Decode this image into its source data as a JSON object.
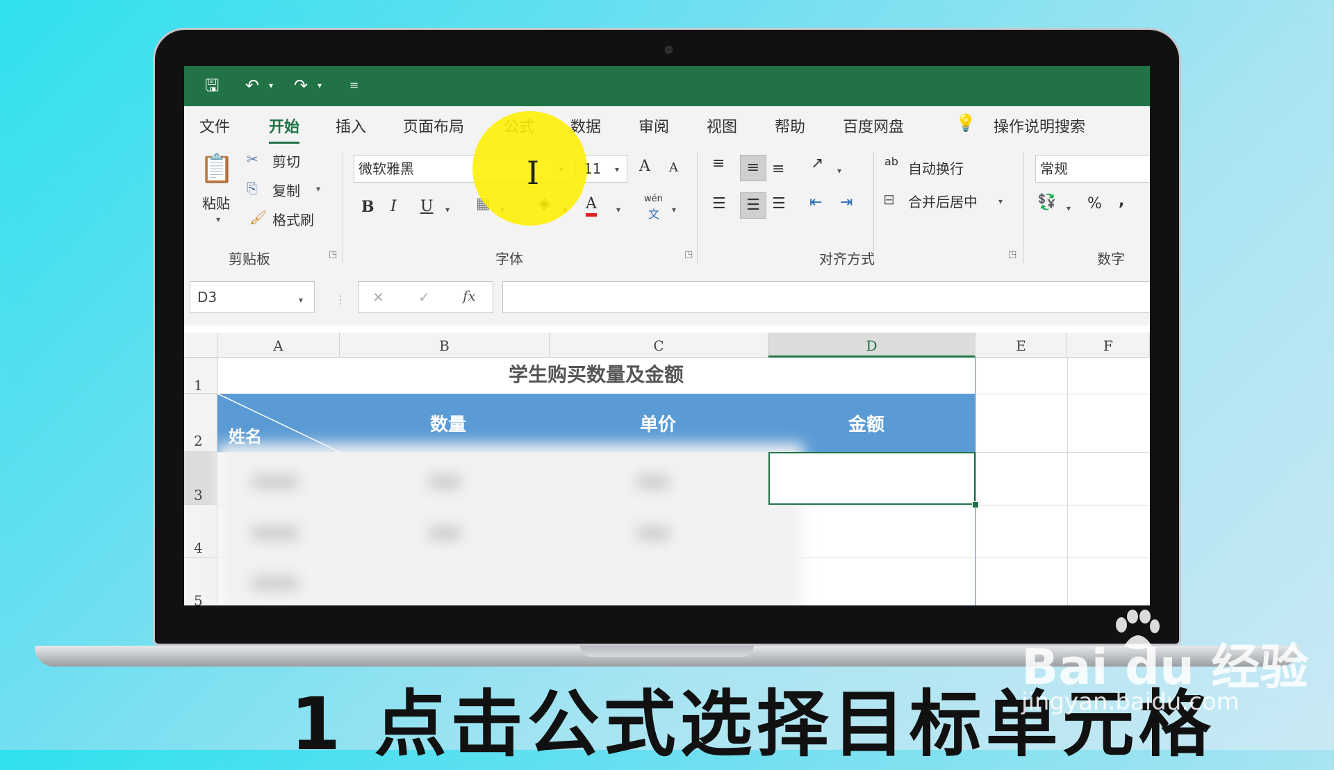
{
  "qat": {
    "save": "🖫",
    "undo": "↶",
    "redo": "↷",
    "customize": "≡"
  },
  "tabs": [
    "文件",
    "开始",
    "插入",
    "页面布局",
    "公式",
    "数据",
    "审阅",
    "视图",
    "帮助",
    "百度网盘"
  ],
  "help_search": "操作说明搜索",
  "clipboard": {
    "paste": "粘贴",
    "cut": "剪切",
    "copy": "复制",
    "format_painter": "格式刷",
    "group": "剪贴板"
  },
  "font": {
    "name": "微软雅黑",
    "size": "11",
    "bold": "B",
    "italic": "I",
    "underline": "U",
    "grow": "A",
    "shrink": "A",
    "color_letter": "A",
    "phonetic": "wén",
    "phonetic_sub": "文",
    "group": "字体"
  },
  "alignment": {
    "wrap": "自动换行",
    "merge": "合并后居中",
    "group": "对齐方式",
    "wrap_icon": "ab"
  },
  "number": {
    "format": "常规",
    "percent": "%",
    "comma": ",",
    "group": "数字"
  },
  "formula_bar": {
    "name_box": "D3",
    "cancel": "✕",
    "enter": "✓",
    "fx": "fx",
    "value": ""
  },
  "columns": [
    "A",
    "B",
    "C",
    "D",
    "E",
    "F"
  ],
  "rows": [
    "1",
    "2",
    "3",
    "4",
    "5"
  ],
  "sheet": {
    "title": "学生购买数量及金额",
    "h_name": "姓名",
    "h_qty": "数量",
    "h_price": "单价",
    "h_amount": "金额"
  },
  "subtitle": "1 点击公式选择目标单元格",
  "watermark": {
    "brand": "Bai du 经验",
    "url": "jingyan.baidu.com"
  },
  "colors": {
    "excel_green": "#217346",
    "header_blue": "#5b9bd5",
    "highlight": "#ffee00"
  }
}
